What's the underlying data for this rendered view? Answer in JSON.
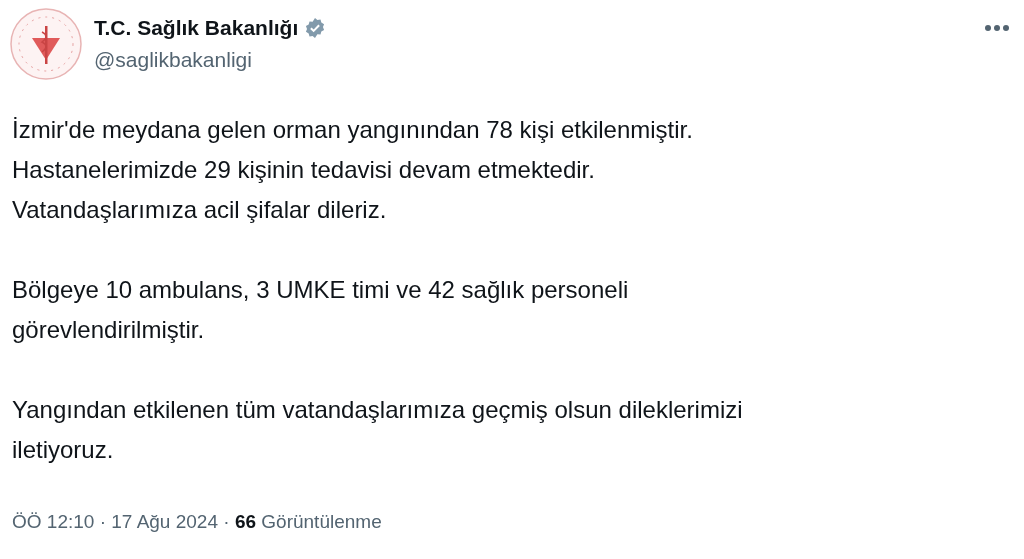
{
  "author": {
    "name": "T.C. Sağlık Bakanlığı",
    "verified": true,
    "handle": "@saglikbakanligi"
  },
  "paragraphs": [
    {
      "lines": [
        "İzmir'de meydana gelen orman yangınından 78 kişi etkilenmiştir.",
        "Hastanelerimizde 29 kişinin tedavisi devam etmektedir.",
        "Vatandaşlarımıza acil şifalar dileriz."
      ]
    },
    {
      "lines": [
        "Bölgeye 10 ambulans, 3 UMKE timi ve 42 sağlık personeli",
        "görevlendirilmiştir."
      ]
    },
    {
      "lines": [
        "Yangından etkilenen tüm vatandaşlarımıza geçmiş olsun dileklerimizi",
        "iletiyoruz."
      ]
    }
  ],
  "meta": "ÖÖ 12:10 · 17 Ağu 2024 · **66** Görüntülenme"
}
